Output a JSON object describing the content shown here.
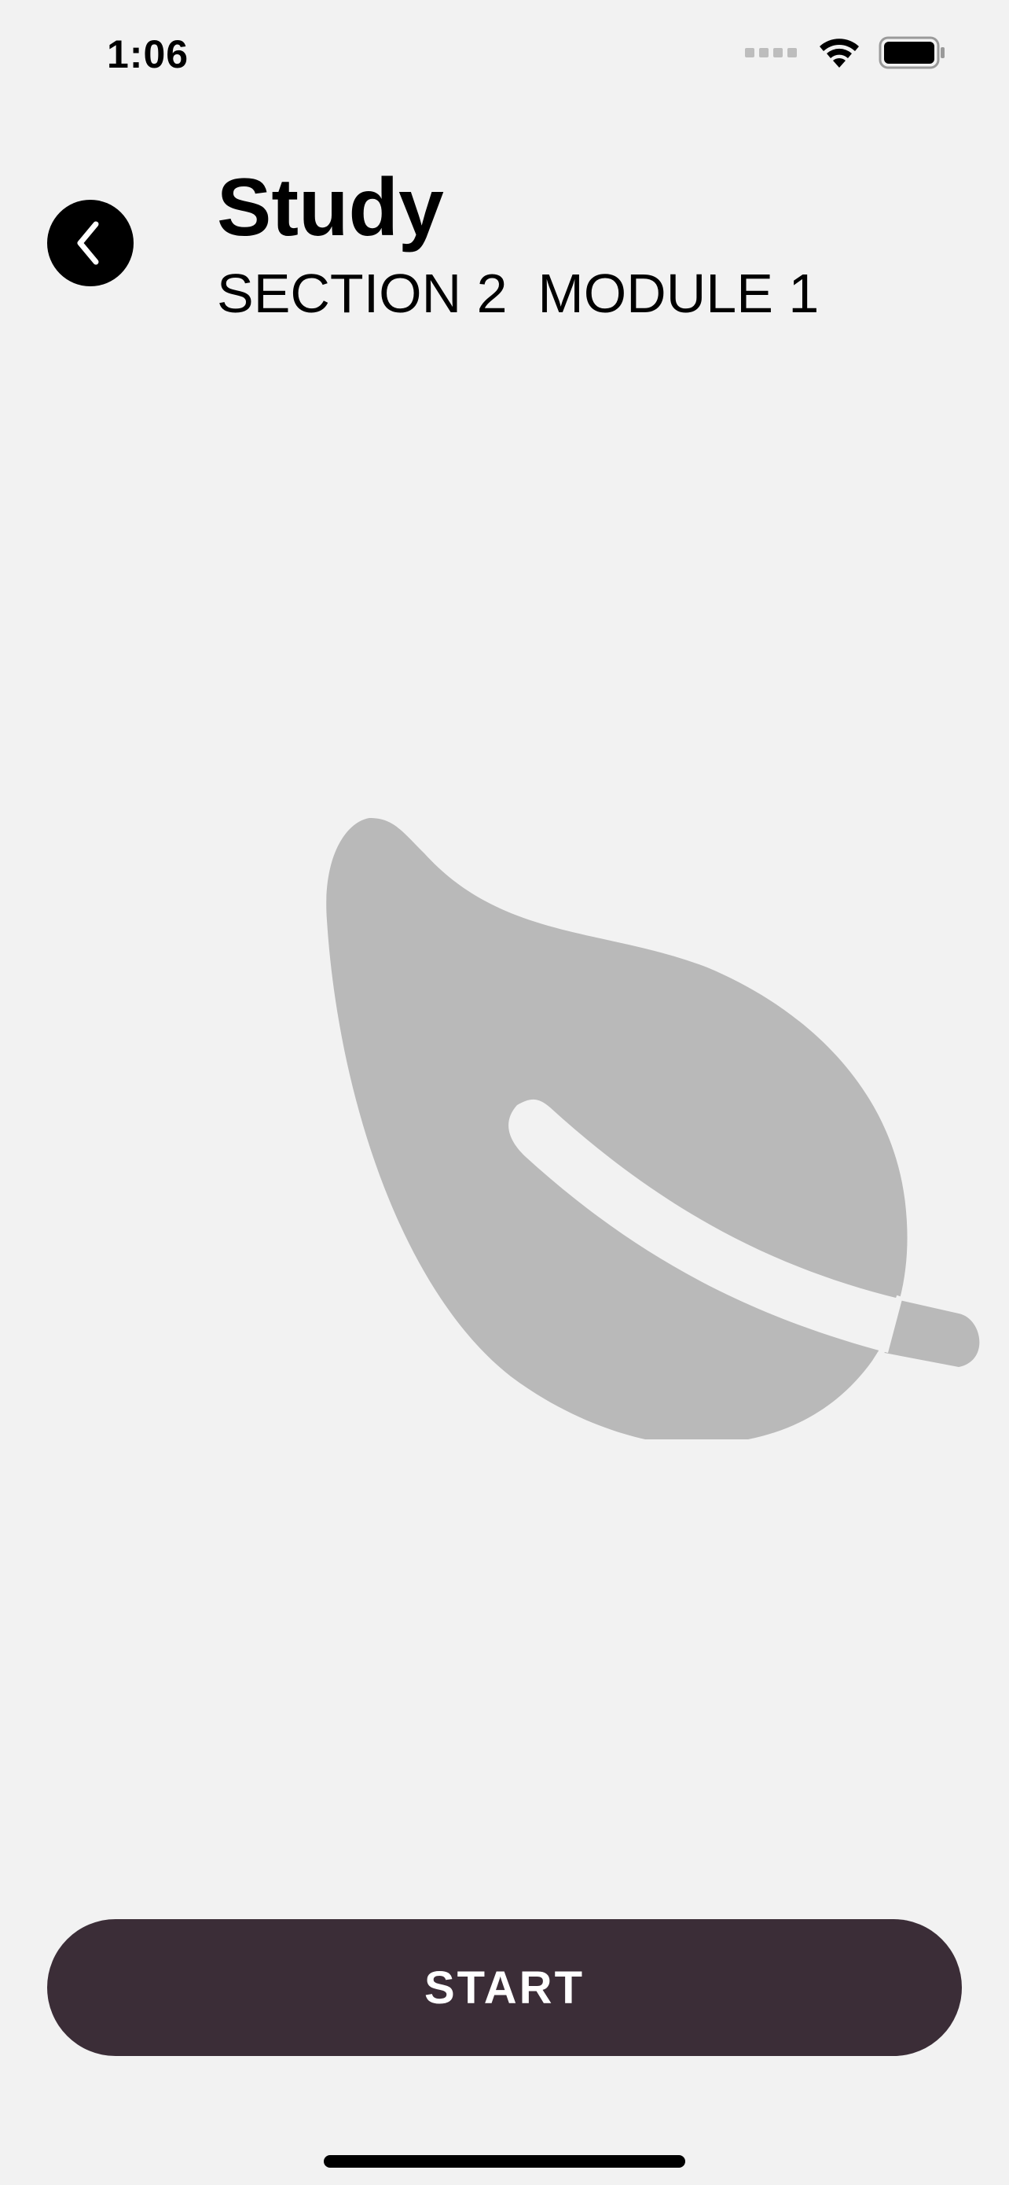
{
  "status_bar": {
    "time": "1:06",
    "icons": [
      "signal-dots-icon",
      "wifi-icon",
      "battery-icon"
    ]
  },
  "header": {
    "back_icon": "chevron-left-icon",
    "title": "Study",
    "subtitle": "SECTION 2  MODULE 1"
  },
  "illustration": {
    "icon": "leaf-icon",
    "color": "#b9b9b9"
  },
  "footer": {
    "start_label": "START"
  },
  "colors": {
    "background": "#f2f2f2",
    "button": "#3b2d37",
    "leaf": "#b9b9b9"
  }
}
